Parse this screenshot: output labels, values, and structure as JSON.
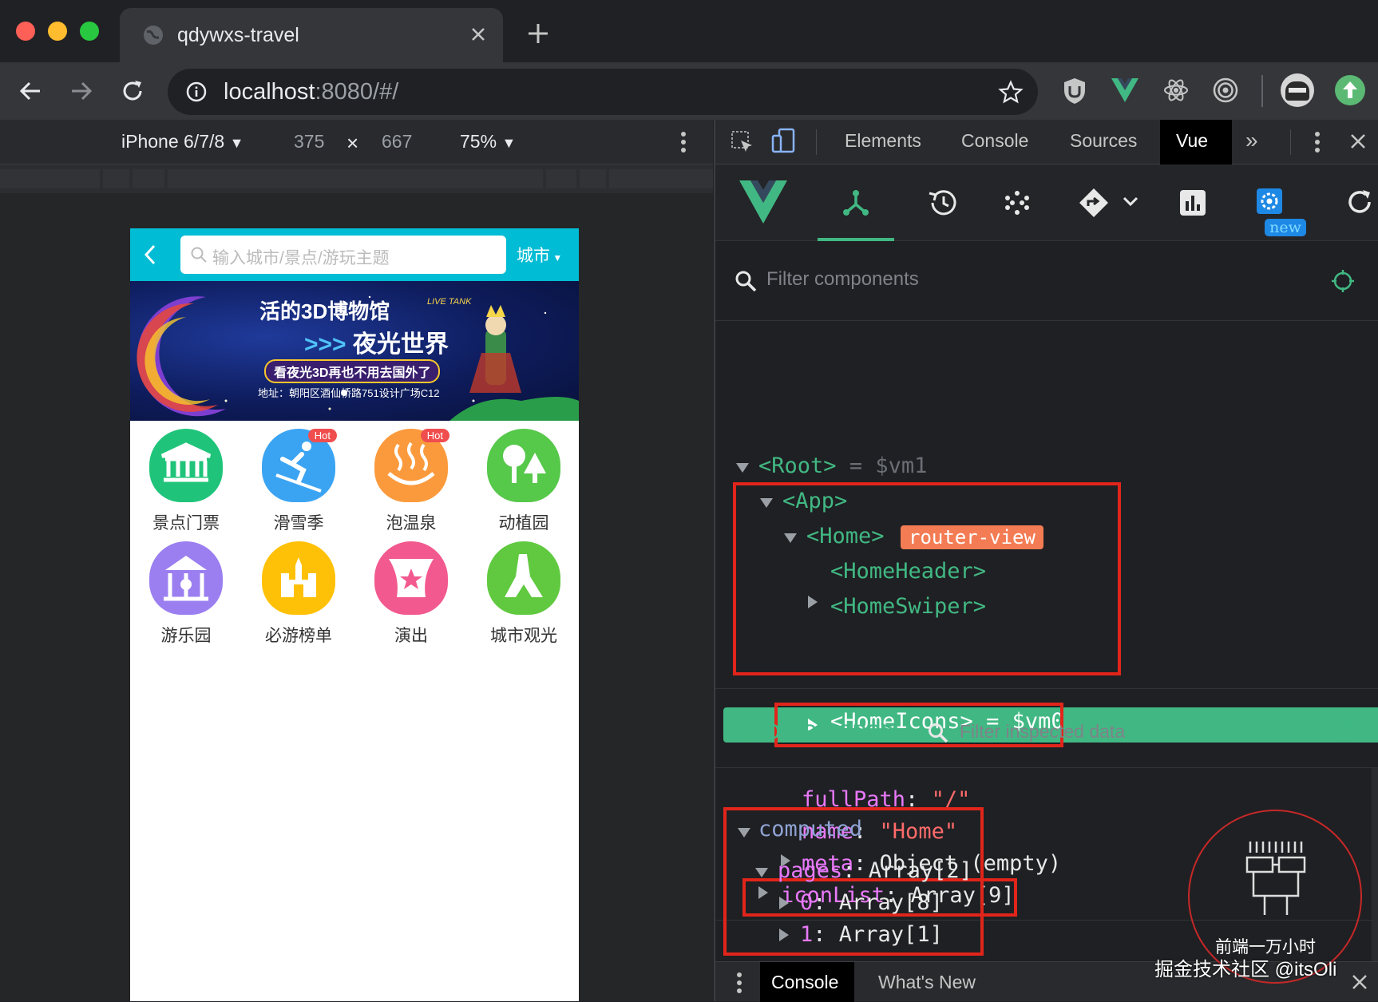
{
  "browser": {
    "tab_title": "qdywxs-travel",
    "url_host": "localhost",
    "url_rest": ":8080/#/"
  },
  "device_toolbar": {
    "device": "iPhone 6/7/8",
    "width": "375",
    "times": "×",
    "height": "667",
    "zoom": "75%"
  },
  "phone": {
    "search_placeholder": "输入城市/景点/游玩主题",
    "city_label": "城市",
    "banner": {
      "line1": "活的3D博物馆",
      "line2": "夜光世界",
      "line3": "看夜光3D再也不用去国外了",
      "line4": "地址：朝阳区酒仙桥路751设计广场C12",
      "tag": "LIVE TANK"
    },
    "hot_label": "Hot",
    "icons": [
      {
        "label": "景点门票",
        "color": "#1fc47a",
        "icon": "museum-icon",
        "hot": false
      },
      {
        "label": "滑雪季",
        "color": "#3ba4f2",
        "icon": "skier-icon",
        "hot": true
      },
      {
        "label": "泡温泉",
        "color": "#fb9a3c",
        "icon": "hot-spring-icon",
        "hot": true
      },
      {
        "label": "动植园",
        "color": "#56c84a",
        "icon": "tree-icon",
        "hot": false
      },
      {
        "label": "游乐园",
        "color": "#9b7ff0",
        "icon": "carousel-icon",
        "hot": false
      },
      {
        "label": "必游榜单",
        "color": "#ffc107",
        "icon": "castle-icon",
        "hot": false
      },
      {
        "label": "演出",
        "color": "#f2598e",
        "icon": "stage-icon",
        "hot": false
      },
      {
        "label": "城市观光",
        "color": "#60c93f",
        "icon": "landmark-icon",
        "hot": false
      }
    ]
  },
  "devtools": {
    "tabs": [
      "Elements",
      "Console",
      "Sources",
      "Vue"
    ],
    "more": "»",
    "filter_placeholder": "Filter components",
    "new_badge": "new",
    "tree": {
      "root": "<Root>",
      "root_vm": "= $vm1",
      "app": "<App>",
      "home": "<Home>",
      "router_view": "router-view",
      "home_header": "<HomeHeader>",
      "home_swiper": "<HomeSwiper>",
      "home_icons": "<HomeIcons>",
      "home_icons_vm": "= $vm0"
    },
    "inspector": {
      "title": "<HomeIcons>",
      "filter_placeholder": "Filter inspected data"
    },
    "state": {
      "fullPath_key": "fullPath",
      "fullPath_val": "\"/\"",
      "name_key": "name",
      "name_val": "\"Home\"",
      "meta_key": "meta",
      "meta_val": "Object (empty)",
      "iconList_key": "iconList",
      "iconList_val": "Array[9]",
      "computed": "computed",
      "pages_key": "pages",
      "pages_val": "Array[2]",
      "p0_key": "0",
      "p0_val": "Array[8]",
      "p1_key": "1",
      "p1_val": "Array[1]"
    },
    "drawer": {
      "console": "Console",
      "whats_new": "What's New"
    }
  },
  "watermark": {
    "line1": "前端一万小时",
    "line2": "掘金技术社区 @itsOli"
  }
}
